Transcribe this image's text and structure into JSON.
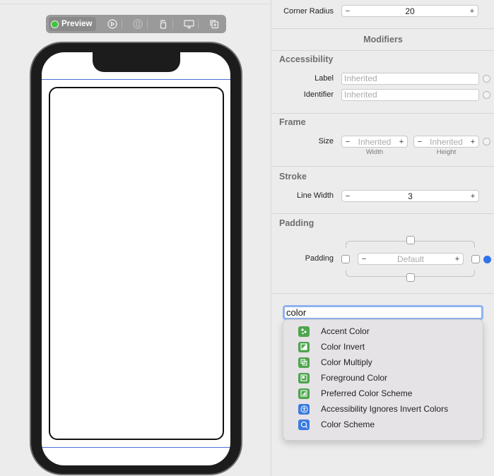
{
  "toolbar": {
    "preview_label": "Preview",
    "buttons": [
      "live-preview",
      "inspect",
      "rotate",
      "device-settings",
      "duplicate"
    ]
  },
  "inspector": {
    "corner_radius": {
      "label": "Corner Radius",
      "value": "20",
      "minus": "−",
      "plus": "+"
    },
    "modifiers_title": "Modifiers",
    "accessibility": {
      "title": "Accessibility",
      "label_row": {
        "label": "Label",
        "placeholder": "Inherited"
      },
      "identifier_row": {
        "label": "Identifier",
        "placeholder": "Inherited"
      }
    },
    "frame": {
      "title": "Frame",
      "size_label": "Size",
      "width": {
        "placeholder": "Inherited",
        "caption": "Width"
      },
      "height": {
        "placeholder": "Inherited",
        "caption": "Height"
      }
    },
    "stroke": {
      "title": "Stroke",
      "line_width_label": "Line Width",
      "value": "3"
    },
    "padding": {
      "title": "Padding",
      "label": "Padding",
      "value": "Default"
    },
    "search": {
      "value": "color"
    },
    "suggestions": [
      {
        "label": "Accent Color",
        "icon": "accent-color-icon",
        "color": "green"
      },
      {
        "label": "Color Invert",
        "icon": "color-invert-icon",
        "color": "green"
      },
      {
        "label": "Color Multiply",
        "icon": "color-multiply-icon",
        "color": "green"
      },
      {
        "label": "Foreground Color",
        "icon": "foreground-color-icon",
        "color": "green"
      },
      {
        "label": "Preferred Color Scheme",
        "icon": "preferred-color-scheme-icon",
        "color": "green"
      },
      {
        "label": "Accessibility Ignores Invert Colors",
        "icon": "accessibility-icon",
        "color": "blue"
      },
      {
        "label": "Color Scheme",
        "icon": "color-scheme-icon",
        "color": "blue"
      }
    ]
  },
  "colors": {
    "accent": "#2f74e8",
    "modifier_green": "#4ea54d",
    "modifier_blue": "#3b7be0",
    "preview_dot": "#3fc33f"
  }
}
